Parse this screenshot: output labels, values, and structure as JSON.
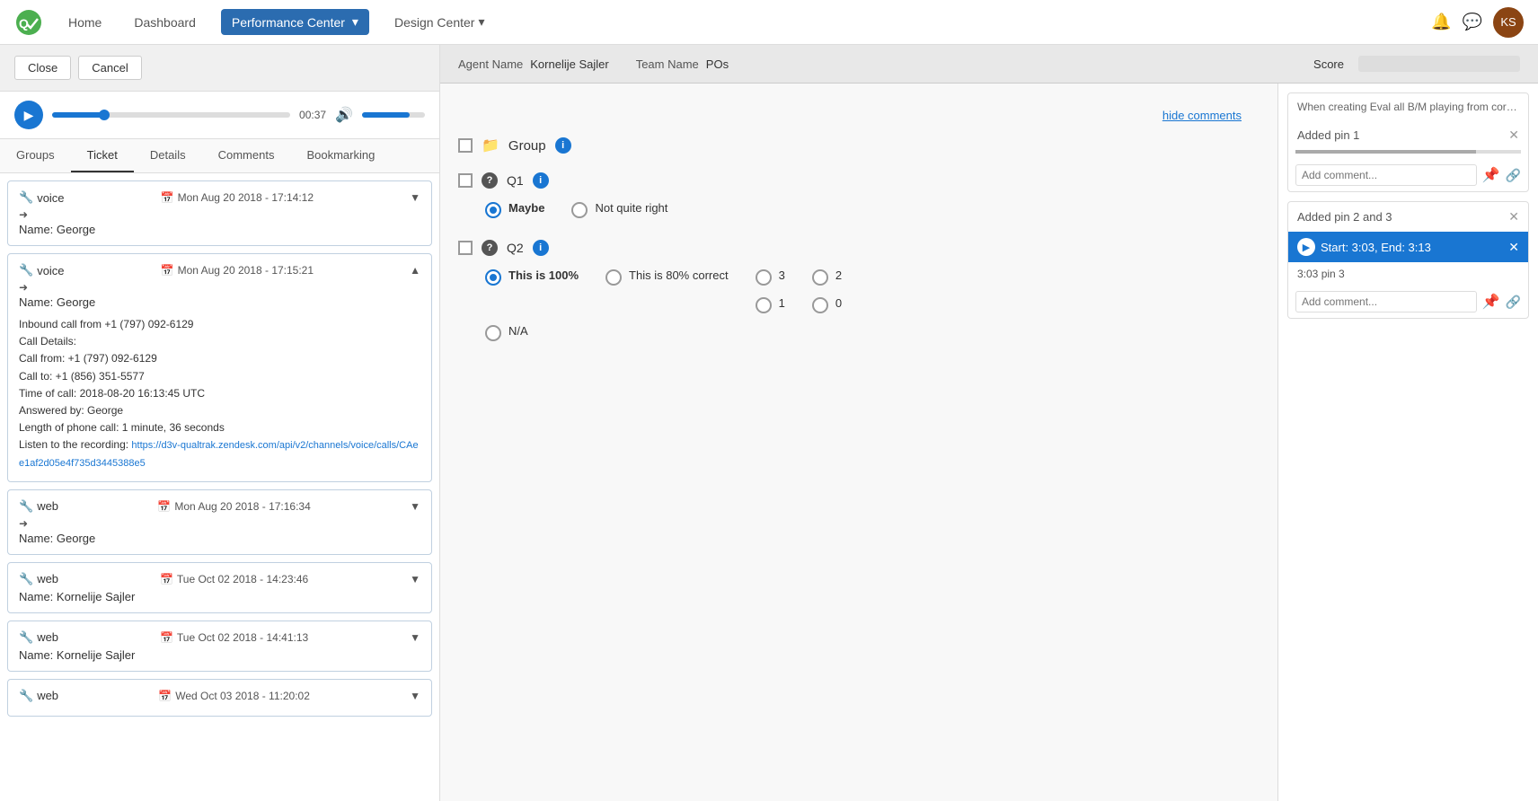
{
  "app": {
    "title": "Performance Center"
  },
  "nav": {
    "logo_text": "Q✓",
    "items": [
      {
        "label": "Home",
        "active": false
      },
      {
        "label": "Dashboard",
        "active": false
      },
      {
        "label": "Performance Center",
        "active": true
      },
      {
        "label": "Design Center",
        "active": false
      }
    ],
    "icons": [
      "bell",
      "chat",
      "avatar"
    ]
  },
  "toolbar": {
    "close_label": "Close",
    "cancel_label": "Cancel"
  },
  "audio": {
    "time": "00:37",
    "progress_pct": 22,
    "volume_pct": 75
  },
  "tabs": {
    "items": [
      "Groups",
      "Ticket",
      "Details",
      "Comments",
      "Bookmarking"
    ],
    "active": "Ticket"
  },
  "tickets": [
    {
      "type": "voice",
      "date": "Mon Aug 20 2018 - 17:14:12",
      "name": "Name: George",
      "expanded": false,
      "arrow": "▼"
    },
    {
      "type": "voice",
      "date": "Mon Aug 20 2018 - 17:15:21",
      "name": "Name: George",
      "expanded": true,
      "arrow": "▲",
      "details": {
        "inbound": "Inbound call from +1 (797) 092-6129",
        "call_details": "Call Details:",
        "call_from": "Call from: +1 (797) 092-6129",
        "call_to": "Call to: +1 (856) 351-5577",
        "time": "Time of call: 2018-08-20 16:13:45 UTC",
        "answered_by": "Answered by: George",
        "length": "Length of phone call: 1 minute, 36 seconds",
        "listen_label": "Listen to the recording:",
        "link": "https://d3v-qualtrak.zendesk.com/api/v2/channels/voice/calls/CAee1af2d05e4f735d3445388e5"
      }
    },
    {
      "type": "web",
      "date": "Mon Aug 20 2018 - 17:16:34",
      "name": "Name: George",
      "expanded": false,
      "arrow": "▼"
    },
    {
      "type": "web",
      "date": "Tue Oct 02 2018 - 14:23:46",
      "name": "Name: Kornelije Sajler",
      "expanded": false,
      "arrow": "▼"
    },
    {
      "type": "web",
      "date": "Tue Oct 02 2018 - 14:41:13",
      "name": "Name: Kornelije Sajler",
      "expanded": false,
      "arrow": "▼"
    },
    {
      "type": "web",
      "date": "Wed Oct 03 2018 - 11:20:02",
      "name": "",
      "expanded": false,
      "arrow": "▼"
    }
  ],
  "score_header": {
    "agent_name_label": "Agent Name",
    "agent_name_value": "Kornelije Sajler",
    "team_name_label": "Team Name",
    "team_name_value": "POs",
    "score_label": "Score"
  },
  "eval": {
    "hide_comments_label": "hide comments",
    "group_label": "Group",
    "questions": [
      {
        "id": "Q1",
        "answers": [
          {
            "label": "Maybe",
            "selected": true
          },
          {
            "label": "Not quite right",
            "selected": false
          }
        ]
      },
      {
        "id": "Q2",
        "answers": [
          {
            "label": "This is 100%",
            "selected": true
          },
          {
            "label": "This is 80% correct",
            "selected": false
          },
          {
            "label": "3",
            "selected": false
          },
          {
            "label": "1",
            "selected": false
          },
          {
            "label": "2",
            "selected": false
          },
          {
            "label": "0",
            "selected": false
          },
          {
            "label": "N/A",
            "selected": false
          }
        ]
      }
    ]
  },
  "comments": [
    {
      "type": "pin1",
      "pin_text": "Added pin 1",
      "has_close": true,
      "input_placeholder": "Add comment...",
      "comment_text": "When creating Eval all B/M playing from correct os"
    },
    {
      "type": "pin2_active",
      "pin_text": "Added pin 2 and 3",
      "has_close": true,
      "highlight_text": "Start: 3:03, End: 3:13",
      "subtext": "3:03 pin 3",
      "input_placeholder": "Add comment..."
    }
  ]
}
